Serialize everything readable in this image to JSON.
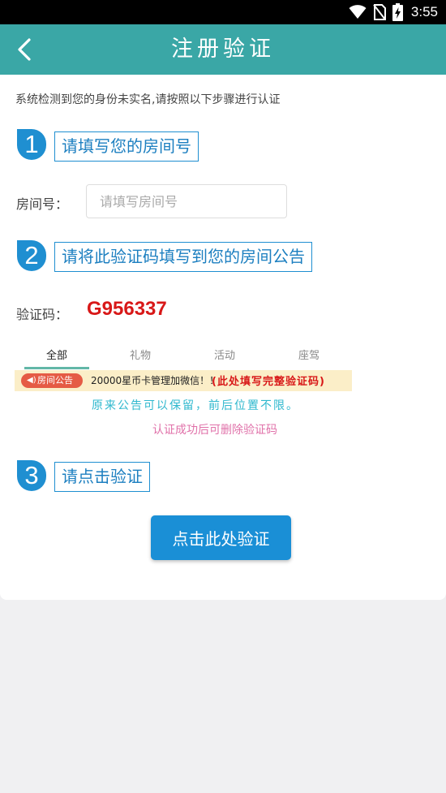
{
  "status_bar": {
    "time": "3:55",
    "icons": [
      "wifi-icon",
      "no-sim-icon",
      "battery-charging-icon"
    ]
  },
  "app_bar": {
    "title": "注册验证",
    "back_icon": "chevron-left-icon"
  },
  "intro": "系统检测到您的身份未实名,请按照以下步骤进行认证",
  "steps": [
    {
      "number": "1",
      "title": "请填写您的房间号"
    },
    {
      "number": "2",
      "title": "请将此验证码填写到您的房间公告"
    },
    {
      "number": "3",
      "title": "请点击验证"
    }
  ],
  "room_field": {
    "label": "房间号：",
    "placeholder": "请填写房间号",
    "value": ""
  },
  "code": {
    "label": "验证码：",
    "value": "G956337"
  },
  "demo": {
    "tabs": [
      "全部",
      "礼物",
      "活动",
      "座驾"
    ],
    "active_tab": "全部",
    "notice_badge": "房间公告",
    "notice_text": "20000星币卡管理加微信！！",
    "notice_highlight": "(此处填写完整验证码)",
    "hint_keep": "原来公告可以保留，前后位置不限。",
    "hint_delete": "认证成功后可删除验证码"
  },
  "verify_button": "点击此处验证",
  "colors": {
    "app_bar": "#3aa7a6",
    "accent_blue": "#1f8fd1",
    "button": "#1a8fd6",
    "code_red": "#d81818",
    "hint_cyan": "#2fb8ce",
    "hint_pink": "#e071a9",
    "notice_bg": "#fbeec8"
  }
}
